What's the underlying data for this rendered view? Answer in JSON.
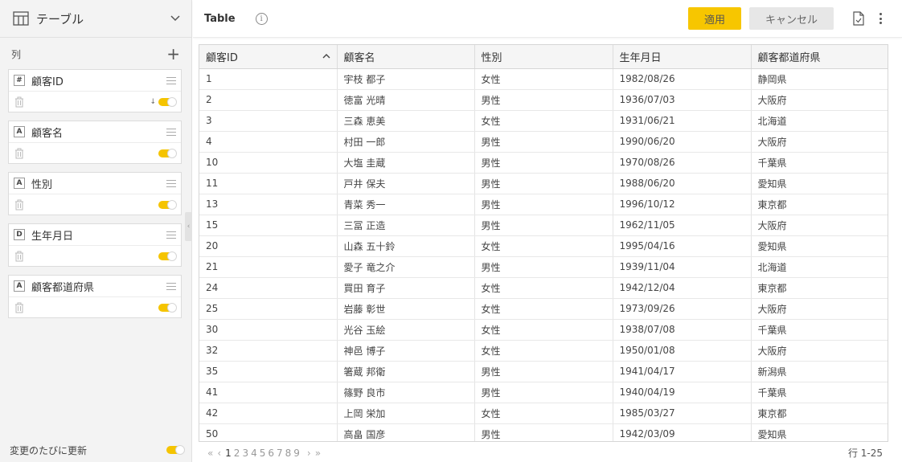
{
  "panel": {
    "title": "テーブル",
    "columns_label": "列",
    "footer_label": "変更のたびに更新"
  },
  "fields": [
    {
      "type": "#",
      "name": "顧客ID",
      "sorted": true
    },
    {
      "type": "A",
      "name": "顧客名",
      "sorted": false
    },
    {
      "type": "A",
      "name": "性別",
      "sorted": false
    },
    {
      "type": "D",
      "name": "生年月日",
      "sorted": false
    },
    {
      "type": "A",
      "name": "顧客都道府県",
      "sorted": false
    }
  ],
  "sort_glyph": "↓",
  "toolbar": {
    "title": "Table",
    "info_glyph": "i",
    "apply_label": "適用",
    "cancel_label": "キャンセル"
  },
  "table": {
    "headers": [
      "顧客ID",
      "顧客名",
      "性別",
      "生年月日",
      "顧客都道府県"
    ],
    "rows": [
      [
        "1",
        "宇枝 都子",
        "女性",
        "1982/08/26",
        "静岡県"
      ],
      [
        "2",
        "徳富 光晴",
        "男性",
        "1936/07/03",
        "大阪府"
      ],
      [
        "3",
        "三森 恵美",
        "女性",
        "1931/06/21",
        "北海道"
      ],
      [
        "4",
        "村田 一郎",
        "男性",
        "1990/06/20",
        "大阪府"
      ],
      [
        "10",
        "大塩 圭蔵",
        "男性",
        "1970/08/26",
        "千葉県"
      ],
      [
        "11",
        "戸井 保夫",
        "男性",
        "1988/06/20",
        "愛知県"
      ],
      [
        "13",
        "青菜 秀一",
        "男性",
        "1996/10/12",
        "東京都"
      ],
      [
        "15",
        "三冨 正造",
        "男性",
        "1962/11/05",
        "大阪府"
      ],
      [
        "20",
        "山森 五十鈴",
        "女性",
        "1995/04/16",
        "愛知県"
      ],
      [
        "21",
        "愛子 竜之介",
        "男性",
        "1939/11/04",
        "北海道"
      ],
      [
        "24",
        "買田 育子",
        "女性",
        "1942/12/04",
        "東京都"
      ],
      [
        "25",
        "岩藤 彰世",
        "女性",
        "1973/09/26",
        "大阪府"
      ],
      [
        "30",
        "光谷 玉絵",
        "女性",
        "1938/07/08",
        "千葉県"
      ],
      [
        "32",
        "神邑 博子",
        "女性",
        "1950/01/08",
        "大阪府"
      ],
      [
        "35",
        "箸蔵 邦衛",
        "男性",
        "1941/04/17",
        "新潟県"
      ],
      [
        "41",
        "篠野 良市",
        "男性",
        "1940/04/19",
        "千葉県"
      ],
      [
        "42",
        "上岡 栄加",
        "女性",
        "1985/03/27",
        "東京都"
      ],
      [
        "50",
        "高畠 国彦",
        "男性",
        "1942/03/09",
        "愛知県"
      ]
    ]
  },
  "pager": {
    "first": "«",
    "prev": "‹",
    "pages": [
      "1",
      "2",
      "3",
      "4",
      "5",
      "6",
      "7",
      "8",
      "9"
    ],
    "active_page": "1",
    "next": "›",
    "last": "»"
  },
  "row_range": "行 1-25",
  "colors": {
    "accent": "#f7c600",
    "panel_bg": "#f3f3f3"
  }
}
